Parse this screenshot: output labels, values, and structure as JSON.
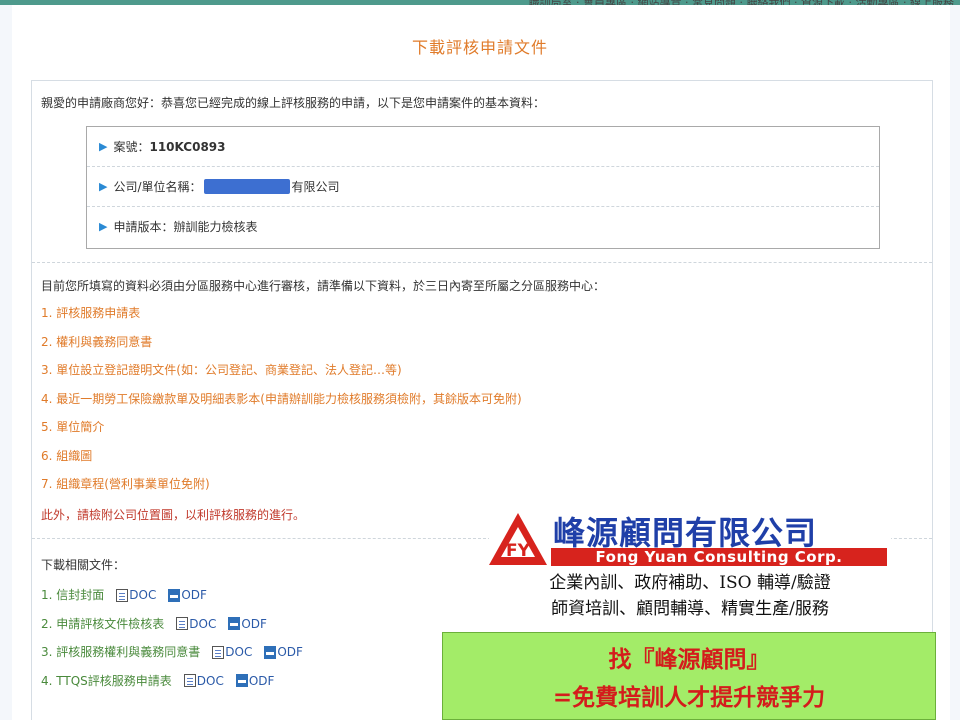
{
  "header": {
    "nav_text": "職訓局室 · 會員專區 · 網站導覽 · 常見問題 · 聯絡我們 · 資源下載 · 活動專區 · 線上服務"
  },
  "page": {
    "title": "下載評核申請文件",
    "greeting": "親愛的申請廠商您好：恭喜您已經完成的線上評核服務的申請，以下是您申請案件的基本資料："
  },
  "info": {
    "case_label": "案號：",
    "case_value": "110KC0893",
    "company_label": "公司/單位名稱：",
    "company_suffix": "有限公司",
    "version_label": "申請版本：",
    "version_value": "辦訓能力檢核表"
  },
  "requirements": {
    "notice": "目前您所填寫的資料必須由分區服務中心進行審核，請準備以下資料，於三日內寄至所屬之分區服務中心：",
    "items": [
      "1. 評核服務申請表",
      "2. 權利與義務同意書",
      "3. 單位設立登記證明文件(如：公司登記、商業登記、法人登記…等)",
      "4. 最近一期勞工保險繳款單及明細表影本(申請辦訓能力檢核服務須檢附，其餘版本可免附)",
      "5. 單位簡介",
      "6. 組織圖",
      "7. 組織章程(營利事業單位免附)"
    ],
    "extra_note": "此外，請檢附公司位置圖，以利評核服務的進行。"
  },
  "downloads": {
    "title": "下載相關文件：",
    "doc_label": "DOC",
    "odf_label": "ODF",
    "items": [
      {
        "label": "1. 信封封面"
      },
      {
        "label": "2. 申請評核文件檢核表"
      },
      {
        "label": "3. 評核服務權利與義務同意書"
      },
      {
        "label": "4. TTQS評核服務申請表"
      }
    ]
  },
  "ad": {
    "company_name": "峰源顧問有限公司",
    "company_en": "Fong Yuan Consulting Corp.",
    "logo_letters": "FY",
    "services_line1": "企業內訓、政府補助、ISO 輔導/驗證",
    "services_line2": "師資培訓、顧問輔導、精實生產/服務",
    "cta_line1": "找『峰源顧問』",
    "cta_line2": "=免費培訓人才提升競爭力"
  },
  "colors": {
    "title_orange": "#e07b2a",
    "topbar_teal": "#4e9a8c",
    "link_blue": "#2b5aa8",
    "ad_red": "#d7231d",
    "ad_blue": "#1f3fa8",
    "cta_green": "#a3ec68"
  }
}
